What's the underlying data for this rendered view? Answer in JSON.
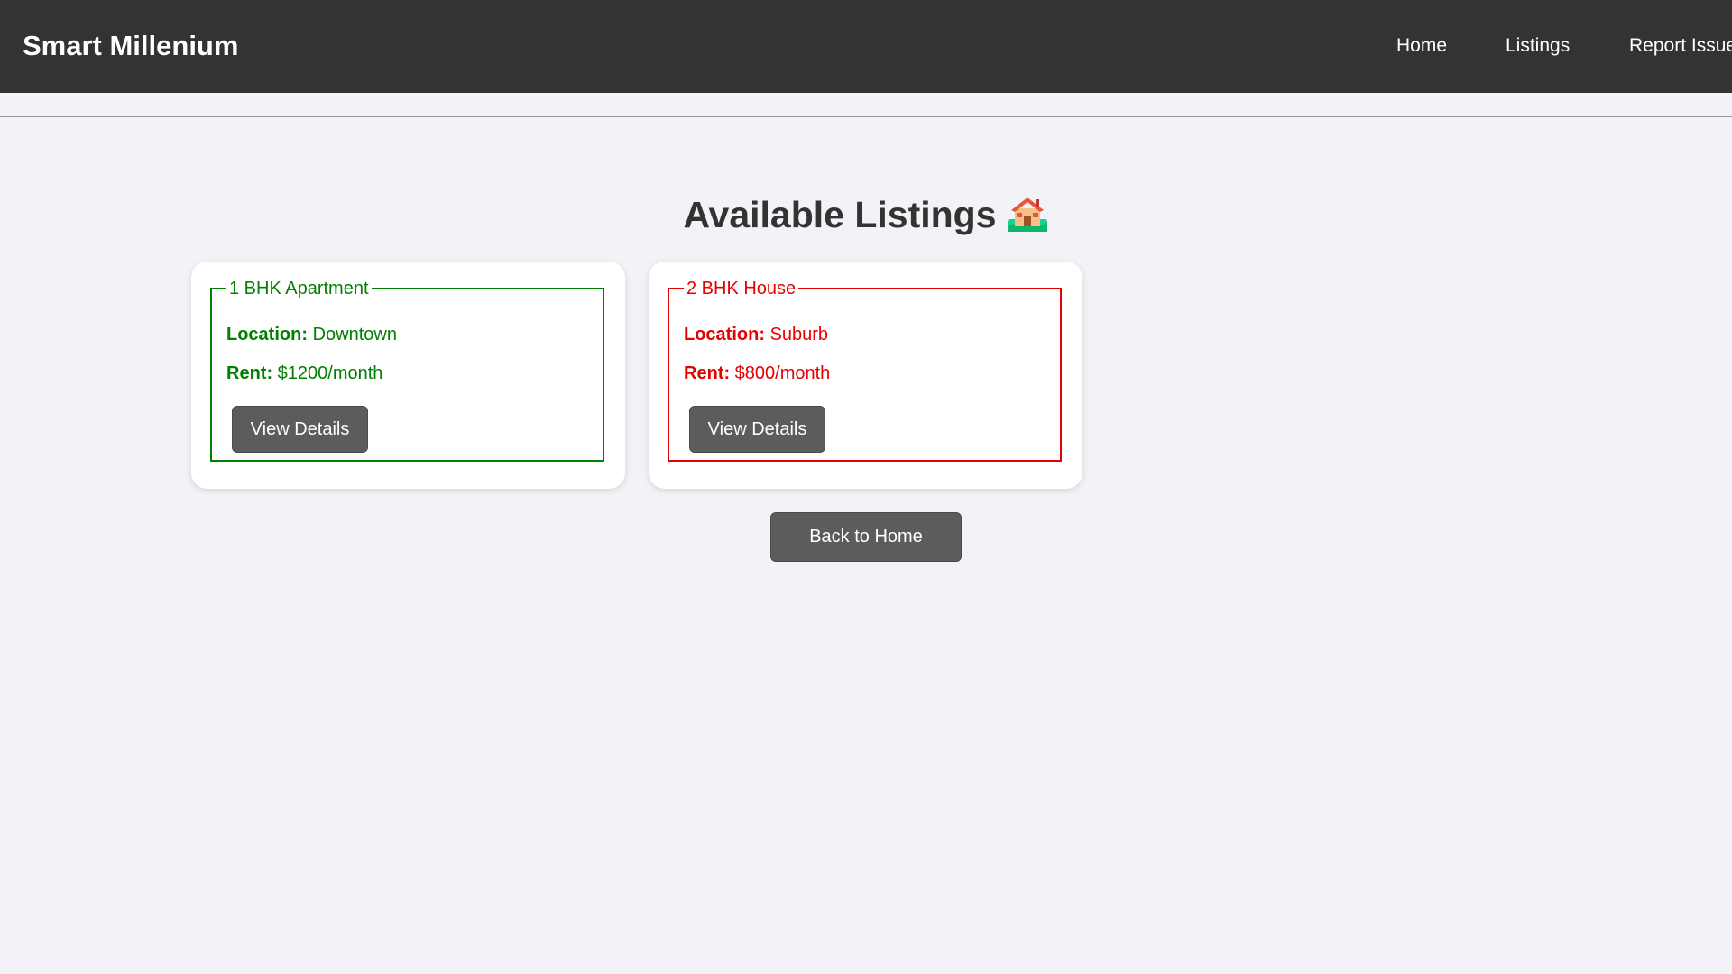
{
  "brand": {
    "title": "Smart Millenium"
  },
  "nav": {
    "items": [
      {
        "label": "Home"
      },
      {
        "label": "Listings"
      },
      {
        "label": "Report Issue"
      }
    ]
  },
  "page": {
    "title": "Available Listings",
    "title_icon": "house-with-garden-icon"
  },
  "listings": [
    {
      "name": "1 BHK Apartment",
      "location_label": "Location:",
      "location": "Downtown",
      "rent_label": "Rent:",
      "rent": "$1200/month",
      "button_label": "View Details",
      "accent_color": "#008000"
    },
    {
      "name": "2 BHK House",
      "location_label": "Location:",
      "location": "Suburb",
      "rent_label": "Rent:",
      "rent": "$800/month",
      "button_label": "View Details",
      "accent_color": "#e60000"
    }
  ],
  "footer": {
    "back_label": "Back to Home"
  },
  "colors": {
    "navbar_bg": "#333333",
    "page_bg": "#f3f3f7",
    "button_bg": "#5c5c5c"
  }
}
